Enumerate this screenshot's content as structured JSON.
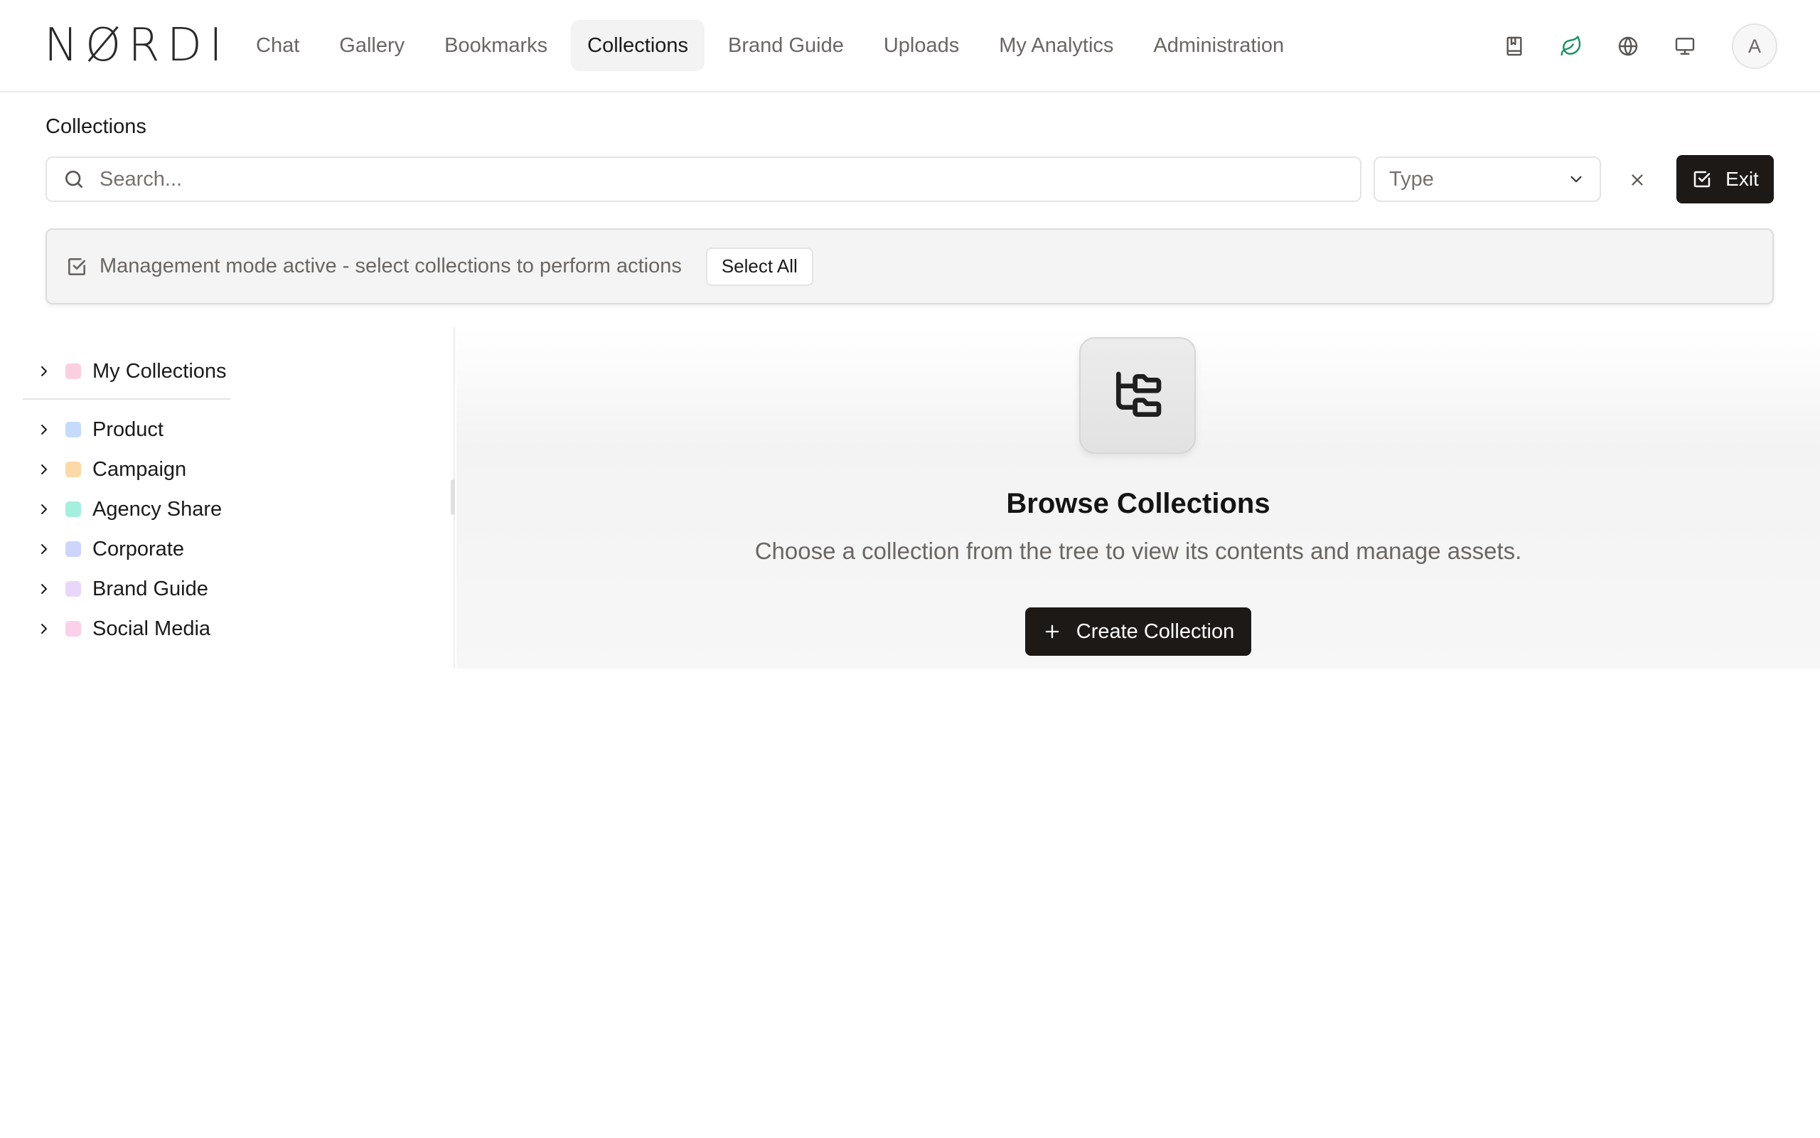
{
  "app": {
    "logo_text": "NØRDI"
  },
  "nav": {
    "items": [
      {
        "label": "Chat"
      },
      {
        "label": "Gallery"
      },
      {
        "label": "Bookmarks"
      },
      {
        "label": "Collections",
        "active": true
      },
      {
        "label": "Brand Guide"
      },
      {
        "label": "Uploads"
      },
      {
        "label": "My Analytics"
      },
      {
        "label": "Administration"
      }
    ]
  },
  "header_icons": [
    "bookmark-book-icon",
    "leaf-icon",
    "globe-icon",
    "monitor-icon"
  ],
  "user": {
    "avatar_initial": "A"
  },
  "page": {
    "title": "Collections"
  },
  "filters": {
    "search_placeholder": "Search...",
    "type_placeholder": "Type",
    "exit_label": "Exit"
  },
  "banner": {
    "text": "Management mode active - select collections to perform actions",
    "select_all_label": "Select All"
  },
  "tree": {
    "my_collections": {
      "label": "My Collections",
      "color": "#fbcfe0"
    },
    "items": [
      {
        "label": "Product",
        "color": "#c4dbfb"
      },
      {
        "label": "Campaign",
        "color": "#fcd9a8"
      },
      {
        "label": "Agency Share",
        "color": "#a6efdf"
      },
      {
        "label": "Corporate",
        "color": "#cdd5fb"
      },
      {
        "label": "Brand Guide",
        "color": "#ead6fb"
      },
      {
        "label": "Social Media",
        "color": "#fbd0ea"
      }
    ]
  },
  "empty_state": {
    "title": "Browse Collections",
    "subtitle": "Choose a collection from the tree to view its contents and manage assets.",
    "create_label": "Create Collection"
  },
  "colors": {
    "primary_button": "#1c1917",
    "accent_leaf": "#1a8f5a",
    "muted_text": "#6b6661"
  }
}
